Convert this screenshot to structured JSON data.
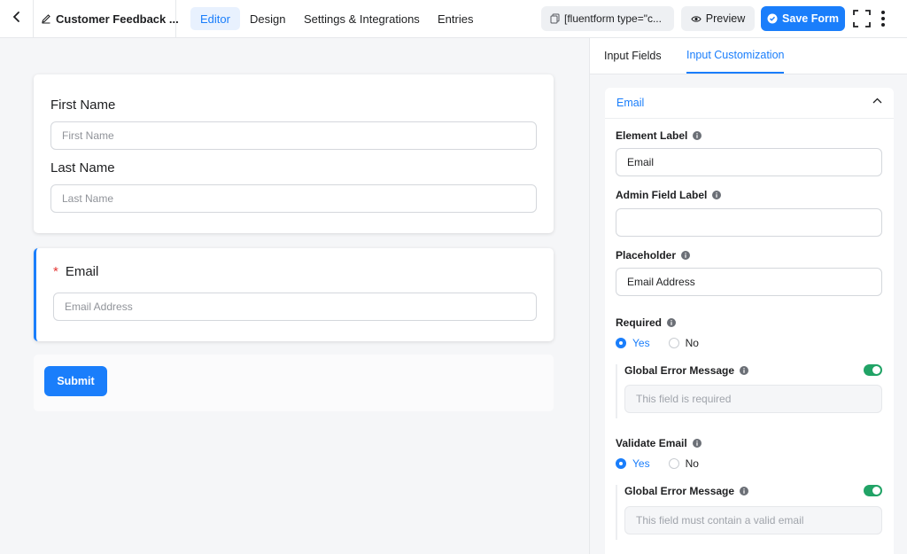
{
  "header": {
    "form_title": "Customer Feedback ...",
    "nav": [
      "Editor",
      "Design",
      "Settings & Integrations",
      "Entries"
    ],
    "shortcode": "[fluentform type=\"c...",
    "preview_label": "Preview",
    "save_label": "Save Form"
  },
  "form": {
    "first_name": {
      "label": "First Name",
      "placeholder": "First Name"
    },
    "last_name": {
      "label": "Last Name",
      "placeholder": "Last Name"
    },
    "email": {
      "required_mark": "*",
      "label": "Email",
      "placeholder": "Email Address"
    },
    "submit_label": "Submit"
  },
  "panel": {
    "tabs": [
      "Input Fields",
      "Input Customization"
    ],
    "section_title": "Email",
    "element_label": {
      "label": "Element Label",
      "value": "Email"
    },
    "admin_field_label": {
      "label": "Admin Field Label",
      "value": ""
    },
    "placeholder": {
      "label": "Placeholder",
      "value": "Email Address"
    },
    "required": {
      "label": "Required",
      "yes": "Yes",
      "no": "No",
      "selected": "Yes",
      "error_label": "Global Error Message",
      "error_enabled": true,
      "error_placeholder": "This field is required"
    },
    "validate_email": {
      "label": "Validate Email",
      "yes": "Yes",
      "no": "No",
      "selected": "Yes",
      "error_label": "Global Error Message",
      "error_enabled": true,
      "error_placeholder": "This field must contain a valid email"
    }
  },
  "colors": {
    "accent": "#1a7efb",
    "toggle_on": "#21a366",
    "required": "#e53935"
  },
  "icons": [
    "chevron-left-icon",
    "pen-icon",
    "copy-icon",
    "eye-icon",
    "check-circle-icon",
    "fullscreen-icon",
    "more-vertical-icon",
    "chevron-up-icon",
    "info-icon"
  ]
}
